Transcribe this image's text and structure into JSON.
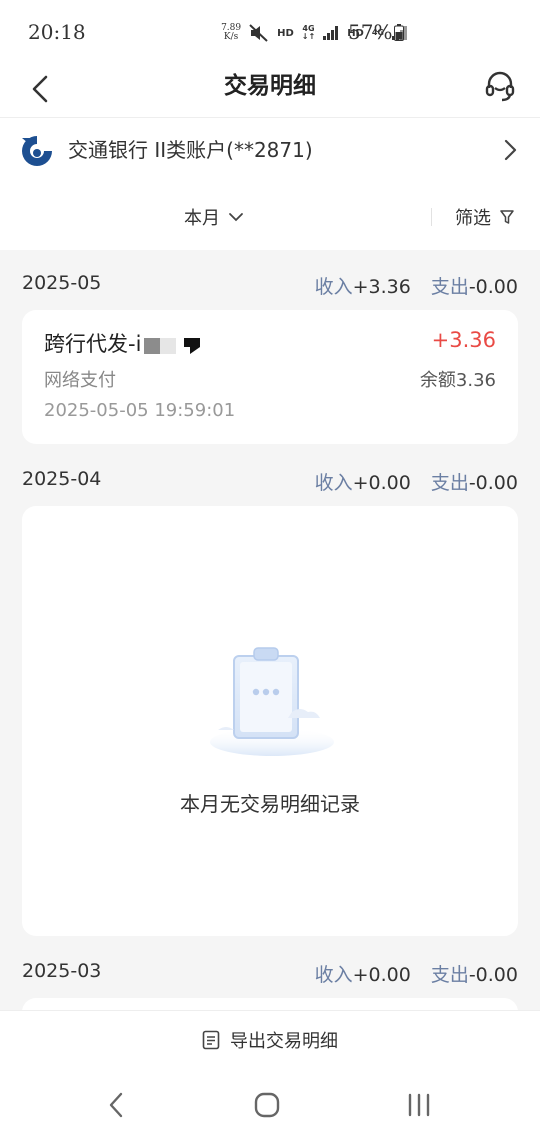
{
  "status_bar": {
    "time": "20:18",
    "net_speed_value": "7.89",
    "net_speed_unit": "K/s",
    "hd1": "HD",
    "net1": "4G",
    "hd2": "HD",
    "net2": "4G",
    "battery": "57%",
    "icons": [
      "mute-icon",
      "signal-icon",
      "battery-icon"
    ]
  },
  "header": {
    "title": "交易明细",
    "back_icon": "chevron-left-icon",
    "service_icon": "headset-icon"
  },
  "account": {
    "name": "交通银行 II类账户(**2871)",
    "logo_color": "#1d4f91"
  },
  "filter": {
    "period": "本月",
    "filter_label": "筛选"
  },
  "months": [
    {
      "label": "2025-05",
      "income_key": "收入",
      "income": "+3.36",
      "expense_key": "支出",
      "expense": "-0.00",
      "transactions": [
        {
          "title": "跨行代发-i",
          "amount": "+3.36",
          "type": "网络支付",
          "balance": "余额3.36",
          "time": "2025-05-05 19:59:01"
        }
      ]
    },
    {
      "label": "2025-04",
      "income_key": "收入",
      "income": "+0.00",
      "expense_key": "支出",
      "expense": "-0.00",
      "empty_text": "本月无交易明细记录"
    },
    {
      "label": "2025-03",
      "income_key": "收入",
      "income": "+0.00",
      "expense_key": "支出",
      "expense": "-0.00"
    }
  ],
  "export": {
    "label": "导出交易明细"
  },
  "colors": {
    "accent_red": "#e94a45",
    "stat_key": "#6b7fa3",
    "background": "#f5f5f5"
  }
}
